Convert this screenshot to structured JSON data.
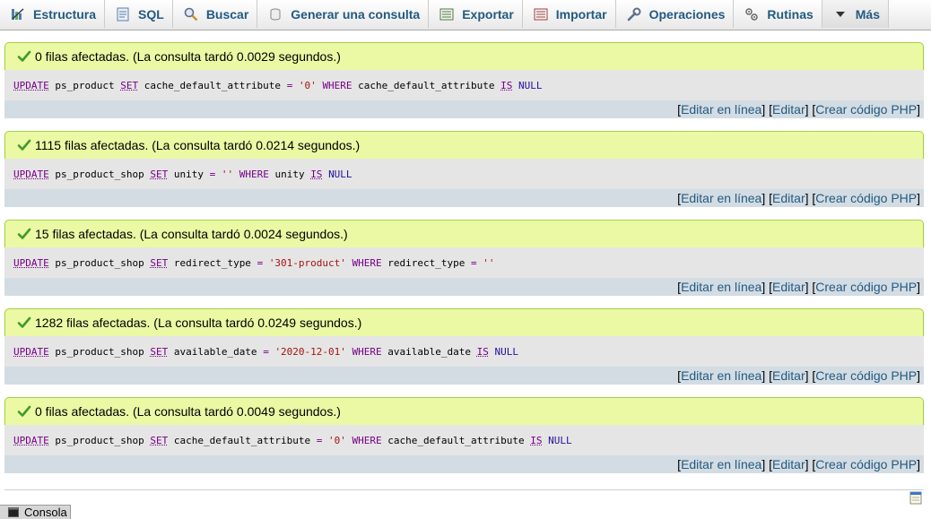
{
  "tabs": [
    {
      "id": "estructura",
      "label": "Estructura",
      "icon": "structure-icon"
    },
    {
      "id": "sql",
      "label": "SQL",
      "icon": "sql-icon"
    },
    {
      "id": "buscar",
      "label": "Buscar",
      "icon": "search-icon"
    },
    {
      "id": "generar",
      "label": "Generar una consulta",
      "icon": "query-icon"
    },
    {
      "id": "exportar",
      "label": "Exportar",
      "icon": "export-icon"
    },
    {
      "id": "importar",
      "label": "Importar",
      "icon": "import-icon"
    },
    {
      "id": "operaciones",
      "label": "Operaciones",
      "icon": "wrench-icon"
    },
    {
      "id": "rutinas",
      "label": "Rutinas",
      "icon": "routines-icon"
    },
    {
      "id": "mas",
      "label": "Más",
      "icon": "triangle-down-icon"
    }
  ],
  "results": [
    {
      "message": "0 filas afectadas. (La consulta tardó 0.0029 segundos.)",
      "sql": [
        {
          "t": "UPDATE",
          "c": "kw"
        },
        {
          "t": " ps_product ",
          "c": "ident"
        },
        {
          "t": "SET",
          "c": "kw"
        },
        {
          "t": " cache_default_attribute ",
          "c": "ident"
        },
        {
          "t": "=",
          "c": "op"
        },
        {
          "t": " ",
          "c": "ident"
        },
        {
          "t": "'0'",
          "c": "str"
        },
        {
          "t": " ",
          "c": "ident"
        },
        {
          "t": "WHERE",
          "c": "kw2"
        },
        {
          "t": " cache_default_attribute ",
          "c": "ident"
        },
        {
          "t": "IS",
          "c": "kw"
        },
        {
          "t": " ",
          "c": "ident"
        },
        {
          "t": "NULL",
          "c": "null"
        }
      ]
    },
    {
      "message": "1115 filas afectadas. (La consulta tardó 0.0214 segundos.)",
      "sql": [
        {
          "t": "UPDATE",
          "c": "kw"
        },
        {
          "t": " ps_product_shop ",
          "c": "ident"
        },
        {
          "t": "SET",
          "c": "kw"
        },
        {
          "t": " unity ",
          "c": "ident"
        },
        {
          "t": "=",
          "c": "op"
        },
        {
          "t": " ",
          "c": "ident"
        },
        {
          "t": "''",
          "c": "str"
        },
        {
          "t": " ",
          "c": "ident"
        },
        {
          "t": "WHERE",
          "c": "kw2"
        },
        {
          "t": " unity ",
          "c": "ident"
        },
        {
          "t": "IS",
          "c": "kw"
        },
        {
          "t": " ",
          "c": "ident"
        },
        {
          "t": "NULL",
          "c": "null"
        }
      ]
    },
    {
      "message": "15 filas afectadas. (La consulta tardó 0.0024 segundos.)",
      "sql": [
        {
          "t": "UPDATE",
          "c": "kw"
        },
        {
          "t": " ps_product_shop ",
          "c": "ident"
        },
        {
          "t": "SET",
          "c": "kw"
        },
        {
          "t": " redirect_type ",
          "c": "ident"
        },
        {
          "t": "=",
          "c": "op"
        },
        {
          "t": " ",
          "c": "ident"
        },
        {
          "t": "'301-product'",
          "c": "str"
        },
        {
          "t": " ",
          "c": "ident"
        },
        {
          "t": "WHERE",
          "c": "kw2"
        },
        {
          "t": " redirect_type ",
          "c": "ident"
        },
        {
          "t": "=",
          "c": "op"
        },
        {
          "t": " ",
          "c": "ident"
        },
        {
          "t": "''",
          "c": "str"
        }
      ]
    },
    {
      "message": "1282 filas afectadas. (La consulta tardó 0.0249 segundos.)",
      "sql": [
        {
          "t": "UPDATE",
          "c": "kw"
        },
        {
          "t": " ps_product_shop ",
          "c": "ident"
        },
        {
          "t": "SET",
          "c": "kw"
        },
        {
          "t": " available_date ",
          "c": "ident"
        },
        {
          "t": "=",
          "c": "op"
        },
        {
          "t": " ",
          "c": "ident"
        },
        {
          "t": "'2020-12-01'",
          "c": "str"
        },
        {
          "t": " ",
          "c": "ident"
        },
        {
          "t": "WHERE",
          "c": "kw2"
        },
        {
          "t": " available_date ",
          "c": "ident"
        },
        {
          "t": "IS",
          "c": "kw"
        },
        {
          "t": " ",
          "c": "ident"
        },
        {
          "t": "NULL",
          "c": "null"
        }
      ]
    },
    {
      "message": "0 filas afectadas. (La consulta tardó 0.0049 segundos.)",
      "sql": [
        {
          "t": "UPDATE",
          "c": "kw"
        },
        {
          "t": " ps_product_shop ",
          "c": "ident"
        },
        {
          "t": "SET",
          "c": "kw"
        },
        {
          "t": " cache_default_attribute ",
          "c": "ident"
        },
        {
          "t": "=",
          "c": "op"
        },
        {
          "t": " ",
          "c": "ident"
        },
        {
          "t": "'0'",
          "c": "str"
        },
        {
          "t": " ",
          "c": "ident"
        },
        {
          "t": "WHERE",
          "c": "kw2"
        },
        {
          "t": " cache_default_attribute ",
          "c": "ident"
        },
        {
          "t": "IS",
          "c": "kw"
        },
        {
          "t": " ",
          "c": "ident"
        },
        {
          "t": "NULL",
          "c": "null"
        }
      ]
    }
  ],
  "links": {
    "open": "[",
    "sep": "] [",
    "close": "]",
    "inline": "Editar en línea",
    "edit": "Editar",
    "php": "Crear código PHP"
  },
  "console": {
    "label": "Consola"
  },
  "colors": {
    "link": "#235a81",
    "success_bg": "#ebf8a4",
    "success_border": "#a2d246",
    "sql_bg": "#e5e5e5",
    "toolbar_bg": "#d3dce3",
    "keyword": "#770088",
    "string": "#aa1111",
    "null": "#221199"
  }
}
